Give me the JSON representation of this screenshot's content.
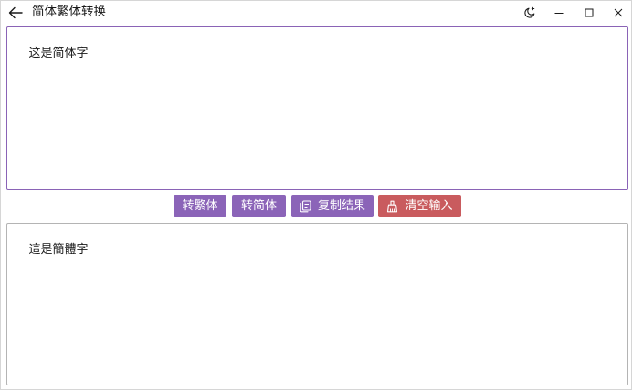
{
  "window": {
    "title": "简体繁体转换"
  },
  "titlebar": {
    "back_icon": "arrow-left-icon",
    "theme_icon": "moon-sparkle-icon",
    "minimize_icon": "minimize-icon",
    "maximize_icon": "maximize-icon",
    "close_icon": "close-icon"
  },
  "input": {
    "value": "这是简体字"
  },
  "toolbar": {
    "to_traditional_label": "转繁体",
    "to_simplified_label": "转简体",
    "copy_label": "复制结果",
    "copy_icon": "copy-icon",
    "clear_label": "清空输入",
    "clear_icon": "broom-icon"
  },
  "output": {
    "value": "這是簡體字"
  },
  "colors": {
    "accent": "#8b64b8",
    "danger": "#c95b5e",
    "input_border": "#8a63b6",
    "output_border": "#b4b4b4"
  }
}
